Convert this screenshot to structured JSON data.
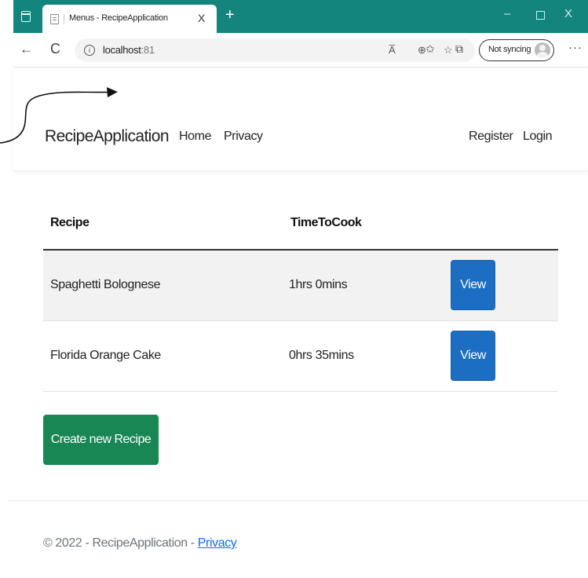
{
  "browser": {
    "tab_title": "Menus - RecipeApplication",
    "tab_close": "X",
    "new_tab": "+",
    "window_minimize": "–",
    "window_close": "X",
    "back_glyph": "←",
    "reload_glyph": "C",
    "address_host": "localhost",
    "address_port": ":81",
    "read_aloud_glyph": "A̅",
    "zoom_glyph": "⊕",
    "favorite_glyph": "☆",
    "favorites_glyph": "✩",
    "collections_glyph": "⧉",
    "sync_label": "Not syncing",
    "more_glyph": "···",
    "theme_color": "#13857c"
  },
  "navbar": {
    "brand": "RecipeApplication",
    "links": [
      "Home",
      "Privacy"
    ],
    "register": "Register",
    "login": "Login"
  },
  "table": {
    "headers": [
      "Recipe",
      "TimeToCook"
    ],
    "rows": [
      {
        "recipe": "Spaghetti Bolognese",
        "time": "1hrs 0mins",
        "action": "View"
      },
      {
        "recipe": "Florida Orange Cake",
        "time": "0hrs 35mins",
        "action": "View"
      }
    ]
  },
  "create_button": "Create new Recipe",
  "footer": {
    "text": "© 2022 - RecipeApplication - ",
    "link": "Privacy"
  },
  "colors": {
    "primary": "#1b6ec2",
    "success": "#198754",
    "link": "#0d6efd"
  }
}
